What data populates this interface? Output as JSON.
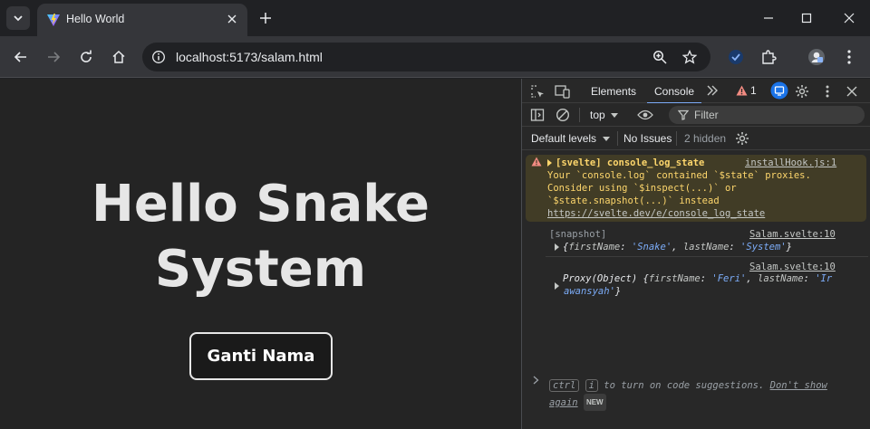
{
  "tabstrip": {
    "tab_title": "Hello World",
    "icons": [
      "tab-search-icon",
      "vite-favicon-icon",
      "close-icon",
      "plus-icon",
      "minimize-icon",
      "maximize-icon",
      "window-close-icon"
    ]
  },
  "toolbar": {
    "url": "localhost:5173/salam.html",
    "icons": [
      "back-icon",
      "forward-icon",
      "reload-icon",
      "home-icon",
      "info-icon",
      "zoom-icon",
      "star-icon",
      "check-shield-icon",
      "extensions-icon",
      "profile-icon",
      "more-icon"
    ]
  },
  "page": {
    "heading_line1": "Hello Snake",
    "heading_line2": "System",
    "button_label": "Ganti Nama"
  },
  "devtools": {
    "tabs": {
      "elements": "Elements",
      "console": "Console"
    },
    "warning_count": "1",
    "context": "top",
    "filter_placeholder": "Filter",
    "default_levels": "Default levels",
    "no_issues": "No Issues",
    "hidden": "2 hidden",
    "warning": {
      "title": "[svelte] console_log_state",
      "source": "installHook.js:1",
      "line1": "Your `console.log` contained `$state` proxies.",
      "line2": "Consider using `$inspect(...)` or",
      "line3": "`$state.snapshot(...)` instead",
      "link": "https://svelte.dev/e/console_log_state"
    },
    "log1": {
      "label": "[snapshot]",
      "source": "Salam.svelte:10",
      "k1": "firstName",
      "v1": "'Snake'",
      "k2": "lastName",
      "v2": "'System'"
    },
    "log2": {
      "source": "Salam.svelte:10",
      "prefix": "Proxy(Object)",
      "k1": "firstName",
      "v1": "'Feri'",
      "k2": "lastName",
      "v2a": "'Ir",
      "v2b": "awansyah'"
    },
    "hint": {
      "kbd1": "ctrl",
      "kbd2": "i",
      "text": "to turn on code suggestions.",
      "dont_show_1": "Don't show",
      "dont_show_2": "again",
      "badge": "NEW"
    }
  },
  "colors": {
    "page_bg": "#242424",
    "warn_bg": "#413c26",
    "warn_text": "#fdd66c",
    "accent": "#7cacf8"
  }
}
